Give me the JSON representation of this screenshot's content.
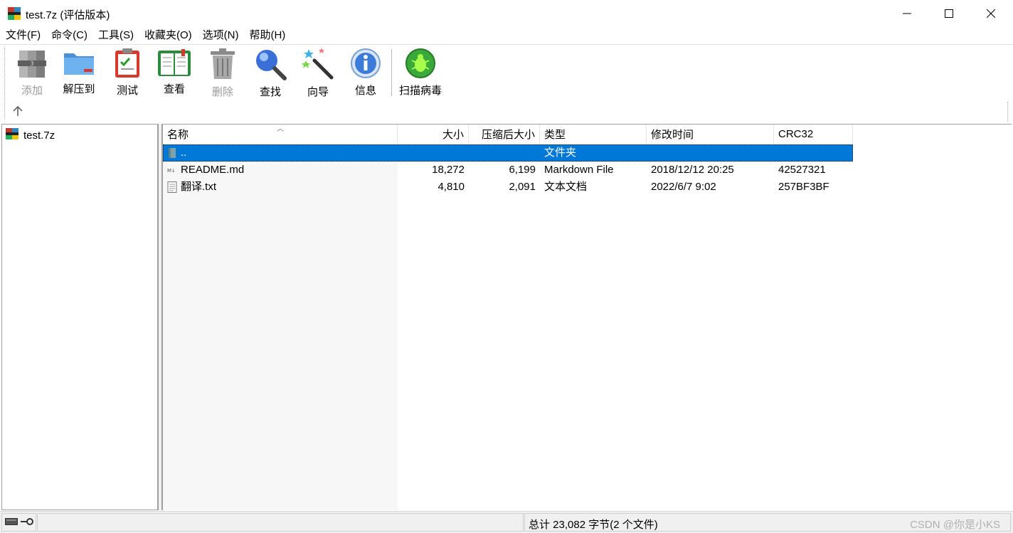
{
  "window": {
    "title": "test.7z (评估版本)"
  },
  "menu": [
    "文件(F)",
    "命令(C)",
    "工具(S)",
    "收藏夹(O)",
    "选项(N)",
    "帮助(H)"
  ],
  "toolbar": {
    "add": "添加",
    "extract": "解压到",
    "test": "测试",
    "view": "查看",
    "delete": "删除",
    "find": "查找",
    "wizard": "向导",
    "info": "信息",
    "scan": "扫描病毒"
  },
  "tree": {
    "root": "test.7z"
  },
  "columns": {
    "name": "名称",
    "size": "大小",
    "packed": "压缩后大小",
    "type": "类型",
    "modified": "修改时间",
    "crc": "CRC32"
  },
  "files": [
    {
      "name": "..",
      "size": "",
      "packed": "",
      "type": "文件夹",
      "modified": "",
      "crc": ""
    },
    {
      "name": "README.md",
      "size": "18,272",
      "packed": "6,199",
      "type": "Markdown File",
      "modified": "2018/12/12 20:25",
      "crc": "42527321"
    },
    {
      "name": "翻译.txt",
      "size": "4,810",
      "packed": "2,091",
      "type": "文本文档",
      "modified": "2022/6/7 9:02",
      "crc": "257BF3BF"
    }
  ],
  "status": {
    "summary": "总计 23,082 字节(2 个文件)",
    "watermark": "CSDN @你是小KS"
  },
  "colors": {
    "selection": "#0078d7"
  }
}
